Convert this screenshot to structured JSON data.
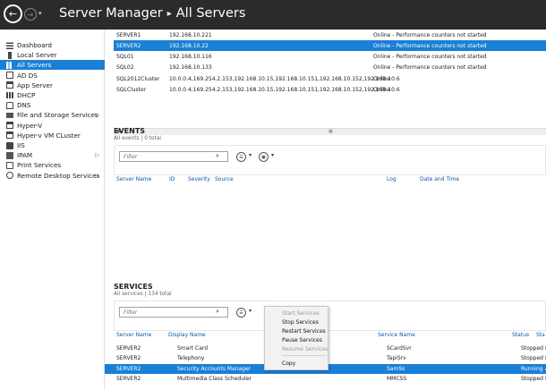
{
  "window": {
    "title_part1": "Server Manager",
    "title_separator": "▸",
    "title_part2": "All Servers"
  },
  "sidebar": {
    "items": [
      {
        "label": "Dashboard",
        "icon": "dashboard-icon",
        "active": false,
        "has_arrow": false
      },
      {
        "label": "Local Server",
        "icon": "server-icon",
        "active": false,
        "has_arrow": false
      },
      {
        "label": "All Servers",
        "icon": "servers-icon",
        "active": true,
        "has_arrow": false
      },
      {
        "label": "AD DS",
        "icon": "ad-ds-icon",
        "active": false,
        "has_arrow": false
      },
      {
        "label": "App Server",
        "icon": "app-server-icon",
        "active": false,
        "has_arrow": false
      },
      {
        "label": "DHCP",
        "icon": "dhcp-icon",
        "active": false,
        "has_arrow": false
      },
      {
        "label": "DNS",
        "icon": "dns-icon",
        "active": false,
        "has_arrow": false
      },
      {
        "label": "File and Storage Services",
        "icon": "file-storage-icon",
        "active": false,
        "has_arrow": true
      },
      {
        "label": "Hyper-V",
        "icon": "hyper-v-icon",
        "active": false,
        "has_arrow": false
      },
      {
        "label": "Hyper-v VM CLuster",
        "icon": "hyper-v-cluster-icon",
        "active": false,
        "has_arrow": false
      },
      {
        "label": "IIS",
        "icon": "iis-icon",
        "active": false,
        "has_arrow": false
      },
      {
        "label": "IPAM",
        "icon": "ipam-icon",
        "active": false,
        "has_arrow": true
      },
      {
        "label": "Print Services",
        "icon": "print-icon",
        "active": false,
        "has_arrow": false
      },
      {
        "label": "Remote Desktop Services",
        "icon": "remote-desktop-icon",
        "active": false,
        "has_arrow": true
      }
    ],
    "arrow_glyph": "▷"
  },
  "servers": {
    "rows": [
      {
        "name": "SERVER1",
        "ip": "192.168.10.221",
        "status": "Online - Performance counters not started",
        "selected": false
      },
      {
        "name": "SERVER2",
        "ip": "192.168.10.22",
        "status": "Online - Performance counters not started",
        "selected": true
      },
      {
        "name": "SQL01",
        "ip": "192.168.10.116",
        "status": "Online - Performance counters not started",
        "selected": false
      },
      {
        "name": "SQL02",
        "ip": "192.168.10.133",
        "status": "Online - Performance counters not started",
        "selected": false
      },
      {
        "name": "SQL2012Cluster",
        "ip": "10.0.0.4,169.254.2.153,192.168.10.15,192.168.10.151,192.168.10.152,192.168.10.6",
        "status": "Online",
        "selected": false
      },
      {
        "name": "SQLCluster",
        "ip": "10.0.0.4,169.254.2.153,192.168.10.15,192.168.10.151,192.168.10.152,192.168.10.6",
        "status": "Online",
        "selected": false
      }
    ],
    "scroll_left_glyph": "◀",
    "scroll_thumb_glyph": "▦"
  },
  "events": {
    "title": "EVENTS",
    "subtitle": "All events | 0 total",
    "filter_placeholder": "Filter",
    "columns": [
      "Server Name",
      "ID",
      "Severity",
      "Source",
      "Log",
      "Date and Time"
    ]
  },
  "services": {
    "title": "SERVICES",
    "subtitle": "All services | 134 total",
    "filter_placeholder": "Filter",
    "columns": [
      "Server Name",
      "Display Name",
      "Service Name",
      "Status",
      "Sta"
    ],
    "rows": [
      {
        "server": "SERVER2",
        "display": "Smart Card",
        "service": "SCardSvr",
        "status": "Stopped",
        "startup": "Disa",
        "selected": false
      },
      {
        "server": "SERVER2",
        "display": "Telephony",
        "service": "TapiSrv",
        "status": "Stopped",
        "startup": "Man",
        "selected": false
      },
      {
        "server": "SERVER2",
        "display": "Security Accounts Manager",
        "service": "SamSs",
        "status": "Running",
        "startup": "Aut",
        "selected": true
      },
      {
        "server": "SERVER2",
        "display": "Multimedia Class Scheduler",
        "service": "MMCSS",
        "status": "Stopped",
        "startup": "Man",
        "selected": false
      }
    ]
  },
  "context_menu": {
    "items": [
      {
        "label": "Start Services",
        "enabled": false
      },
      {
        "label": "Stop Services",
        "enabled": true
      },
      {
        "label": "Restart Services",
        "enabled": true
      },
      {
        "label": "Pause Services",
        "enabled": true
      },
      {
        "label": "Resume Services",
        "enabled": false
      },
      {
        "label": "Copy",
        "enabled": true
      }
    ]
  },
  "colors": {
    "titlebar": "#2b2b2b",
    "accent": "#1a7fd6",
    "column_header": "#0d5aa7"
  },
  "icons": {
    "search": "⌕",
    "dropdown": "▾",
    "back": "←",
    "forward": "→",
    "list_view": "☰",
    "save_view": "▣"
  }
}
